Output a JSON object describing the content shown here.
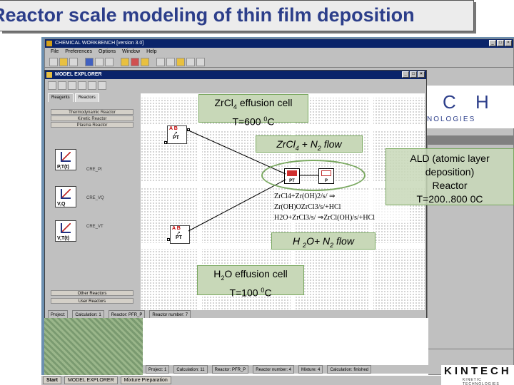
{
  "slide": {
    "title": "Reactor scale modeling of thin film deposition"
  },
  "main_window": {
    "title": "CHEMICAL WORKBENCH [version 3.0]",
    "menu": [
      "File",
      "Preferences",
      "Options",
      "Window",
      "Help"
    ]
  },
  "explorer": {
    "title": "MODEL EXPLORER",
    "tabs": [
      "Reagents",
      "Reactors"
    ],
    "reactor_list": [
      "Thermodynamic Reactor",
      "Kinetic Reactor",
      "Plasma Reactor"
    ],
    "reactors": [
      {
        "icon_label": "P,T(t)",
        "name": "CRE_Pt"
      },
      {
        "icon_label": "V,Q",
        "name": "CRE_VQ"
      },
      {
        "icon_label": "V,T(t)",
        "name": "CRE_VT"
      }
    ],
    "other_reactors": "Other Reactors",
    "user_reactors": "User Reactors",
    "status": [
      "Project:",
      "Calculation: 1",
      "Reactor: PFR_P",
      "Reactor number: 7"
    ]
  },
  "callouts": {
    "zrcl4_cell_line1": "ZrCl",
    "zrcl4_cell_sub": "4",
    "zrcl4_cell_line1_rest": " effusion cell",
    "zrcl4_cell_line2": "T=600 ",
    "zrcl4_cell_sup": "0",
    "zrcl4_cell_unit": "C",
    "zrcl4_flow": "ZrCl",
    "zrcl4_flow_sub": "4",
    "zrcl4_flow_rest": " + N",
    "zrcl4_flow_sub2": "2",
    "zrcl4_flow_end": " flow",
    "h2o_flow_pre": "H ",
    "h2o_flow_sub": "2",
    "h2o_flow_rest": "O+ N",
    "h2o_flow_sub2": "2",
    "h2o_flow_end": " flow",
    "h2o_cell_pre": "H",
    "h2o_cell_sub": "2",
    "h2o_cell_rest": "O effusion cell",
    "h2o_cell_line2": "T=100 ",
    "h2o_cell_sup": "0",
    "h2o_cell_unit": "C",
    "ald_line1": "ALD (atomic layer",
    "ald_line2": "deposition)",
    "ald_line3": "Reactor",
    "ald_line4": "T=200..800 0C"
  },
  "reactions": [
    "ZrCl4+Zr(OH)2/s/ ⇒",
    "Zr(OH)OZrCl3/s/+HCl",
    "H2O+ZrCl3/s/ ⇒ZrCl(OH)/s/+HCl"
  ],
  "nodes": {
    "pt_label": "PT",
    "ab_label": "A B",
    "p_label": "P"
  },
  "logo": {
    "big": "C H",
    "small": "NOLOGIES",
    "kintech": "KINTECH",
    "kintech_sub": "KINETIC TECHNOLOGIES"
  },
  "bottom_status": [
    "Project: 1",
    "Calculation: 11",
    "Reactor: PFR_P",
    "Reactor number: 4",
    "Mixture: 4",
    "Calculation: finished"
  ],
  "taskbar": {
    "start": "Start",
    "items": [
      "MODEL EXPLORER",
      "Mixture Preparation"
    ]
  }
}
